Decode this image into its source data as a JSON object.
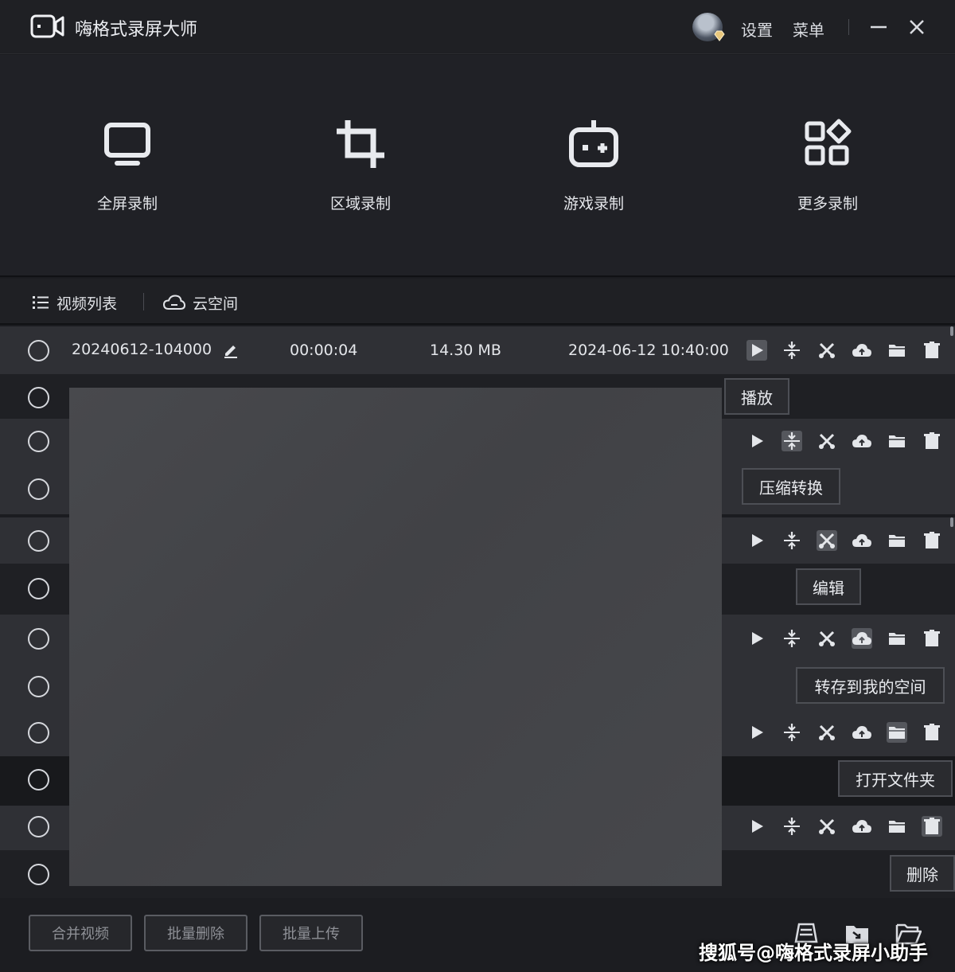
{
  "app": {
    "title": "嗨格式录屏大师"
  },
  "titlebar": {
    "settings_label": "设置",
    "menu_label": "菜单"
  },
  "modes": [
    {
      "label": "全屏录制",
      "icon": "monitor-icon"
    },
    {
      "label": "区域录制",
      "icon": "crop-icon"
    },
    {
      "label": "游戏录制",
      "icon": "gamepad-icon"
    },
    {
      "label": "更多录制",
      "icon": "apps-grid-icon"
    }
  ],
  "tabs": [
    {
      "label": "视频列表",
      "icon": "list-icon"
    },
    {
      "label": "云空间",
      "icon": "cloud-icon"
    }
  ],
  "video_list": {
    "first_item": {
      "filename": "20240612-104000",
      "duration": "00:00:04",
      "size": "14.30 MB",
      "created": "2024-06-12 10:40:00"
    },
    "actions": [
      "play-icon",
      "compress-icon",
      "edit-cut-icon",
      "cloud-upload-icon",
      "folder-icon",
      "trash-icon"
    ],
    "tooltips": [
      "播放",
      "压缩转换",
      "编辑",
      "转存到我的空间",
      "打开文件夹",
      "删除"
    ]
  },
  "bottom": {
    "buttons": [
      "合并视频",
      "批量删除",
      "批量上传"
    ],
    "icons": [
      "import-icon",
      "export-icon",
      "open-folder-icon"
    ]
  },
  "watermark": "搜狐号@嗨格式录屏小助手",
  "colors": {
    "background": "#1f2024",
    "row_alt": "#2f3035",
    "text": "#e4e6ea"
  }
}
